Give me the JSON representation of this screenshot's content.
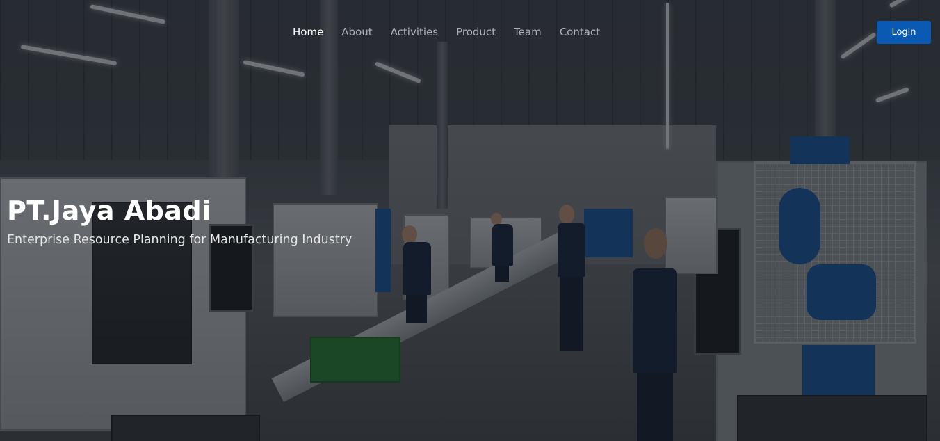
{
  "nav": {
    "items": [
      {
        "label": "Home",
        "active": true
      },
      {
        "label": "About",
        "active": false
      },
      {
        "label": "Activities",
        "active": false
      },
      {
        "label": "Product",
        "active": false
      },
      {
        "label": "Team",
        "active": false
      },
      {
        "label": "Contact",
        "active": false
      }
    ],
    "login_label": "Login"
  },
  "hero": {
    "title": "PT.Jaya Abadi",
    "subtitle": "Enterprise Resource Planning for Manufacturing Industry",
    "background": "factory-production-line-photo"
  },
  "colors": {
    "accent": "#0a5ab4",
    "overlay": "#0c1016",
    "nav_active": "#ffffff",
    "nav_inactive": "#a0a3a6"
  }
}
